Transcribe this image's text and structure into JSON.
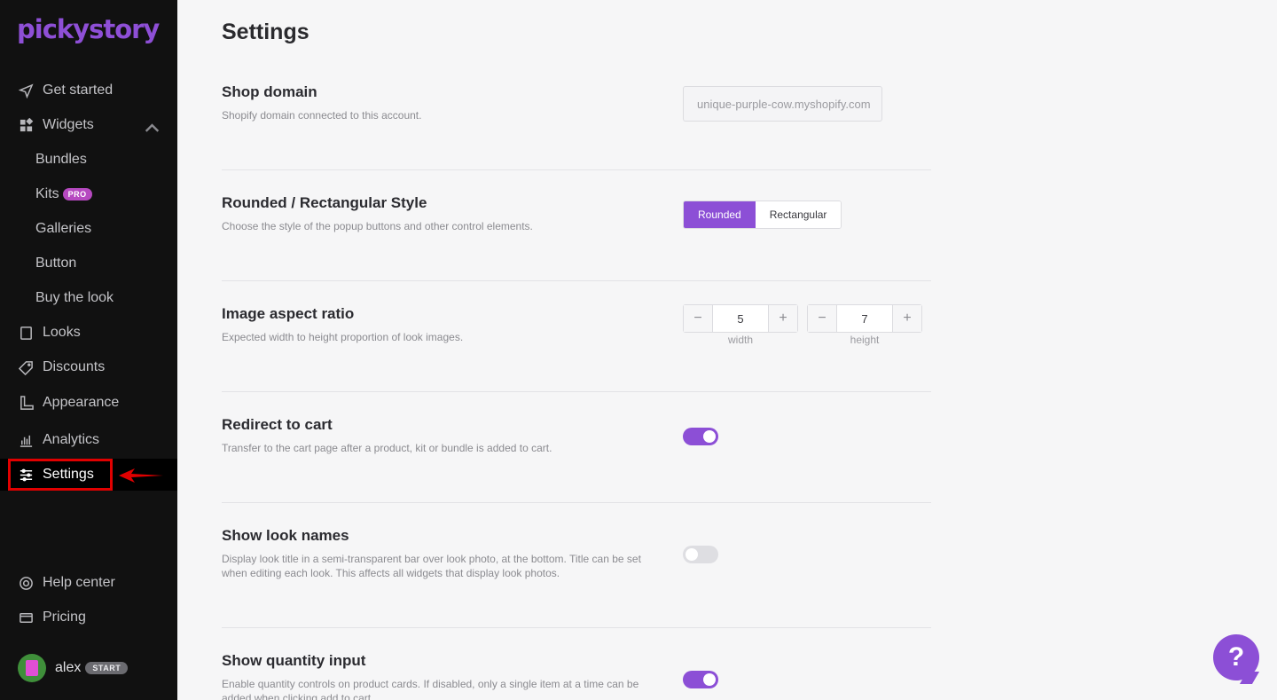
{
  "sidebar": {
    "logo": "pickystory",
    "nav": {
      "get_started": "Get started",
      "widgets": "Widgets",
      "bundles": "Bundles",
      "kits": "Kits",
      "kits_badge": "PRO",
      "galleries": "Galleries",
      "button": "Button",
      "buy_the_look": "Buy the look",
      "looks": "Looks",
      "discounts": "Discounts",
      "appearance": "Appearance",
      "analytics": "Analytics",
      "settings": "Settings",
      "help_center": "Help center",
      "pricing": "Pricing"
    },
    "user": {
      "name": "alex",
      "plan_badge": "START"
    }
  },
  "main": {
    "title": "Settings",
    "shop_domain": {
      "title": "Shop domain",
      "desc": "Shopify domain connected to this account.",
      "value": "unique-purple-cow.myshopify.com"
    },
    "style": {
      "title": "Rounded / Rectangular Style",
      "desc": "Choose the style of the popup buttons and other control elements.",
      "options": [
        "Rounded",
        "Rectangular"
      ],
      "selected": "Rounded"
    },
    "aspect": {
      "title": "Image aspect ratio",
      "desc": "Expected width to height proportion of look images.",
      "width_value": "5",
      "height_value": "7",
      "width_label": "width",
      "height_label": "height",
      "minus": "−",
      "plus": "+"
    },
    "redirect": {
      "title": "Redirect to cart",
      "desc": "Transfer to the cart page after a product, kit or bundle is added to cart.",
      "enabled": true
    },
    "look_names": {
      "title": "Show look names",
      "desc": "Display look title in a semi-transparent bar over look photo, at the bottom. Title can be set when editing each look. This affects all widgets that display look photos.",
      "enabled": false
    },
    "quantity": {
      "title": "Show quantity input",
      "desc": "Enable quantity controls on product cards. If disabled, only a single item at a time can be added when clicking add to cart.",
      "enabled": true
    }
  },
  "help_button": "?",
  "colors": {
    "accent": "#8c4fd6",
    "sidebar_bg": "#111111",
    "highlight": "#e00000"
  }
}
